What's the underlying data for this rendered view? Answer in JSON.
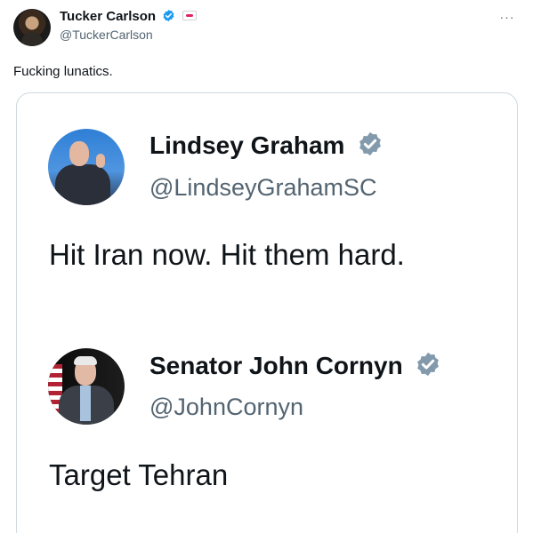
{
  "post": {
    "author_name": "Tucker Carlson",
    "author_handle": "@TuckerCarlson",
    "text": "Fucking lunatics.",
    "more_label": "···"
  },
  "quote": {
    "tweets": [
      {
        "name": "Lindsey Graham",
        "handle": "@LindseyGrahamSC",
        "text": "Hit Iran now. Hit them hard."
      },
      {
        "name": "Senator John Cornyn",
        "handle": "@JohnCornyn",
        "text": "Target Tehran"
      }
    ]
  },
  "colors": {
    "verified_main": "#1d9bf0",
    "verified_gray": "#829aab",
    "handle_text": "#536471",
    "card_border": "#cfd9de"
  },
  "icons": {
    "verified_main": "verified-badge-icon",
    "affiliate": "affiliate-badge-icon",
    "verified_gray": "verified-gray-badge-icon"
  }
}
